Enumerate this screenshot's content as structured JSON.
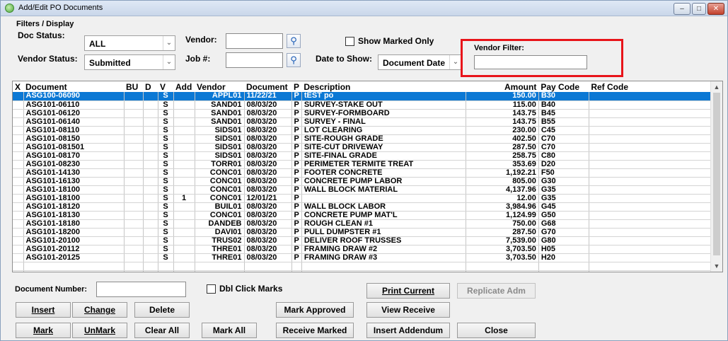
{
  "window": {
    "title": "Add/Edit PO Documents",
    "controls": {
      "minimize": "–",
      "maximize": "□",
      "close": "✕"
    }
  },
  "filters": {
    "section_title": "Filters / Display",
    "doc_status_label": "Doc Status:",
    "doc_status_value": "ALL",
    "vendor_status_label": "Vendor Status:",
    "vendor_status_value": "Submitted",
    "vendor_label": "Vendor:",
    "vendor_value": "",
    "job_label": "Job #:",
    "job_value": "",
    "show_marked_only_label": "Show Marked Only",
    "date_to_show_label": "Date to Show:",
    "date_to_show_value": "Document Date",
    "vendor_filter_label": "Vendor Filter:",
    "vendor_filter_value": ""
  },
  "grid": {
    "columns": [
      "X",
      "Document",
      "BU",
      "D",
      "V",
      "Add",
      "Vendor",
      "Document",
      "P",
      "Description",
      "Amount",
      "Pay Code",
      "Ref Code"
    ],
    "rows": [
      [
        "",
        "ASG100-06090",
        "",
        "",
        "S",
        "",
        "APPL01",
        "11/22/21",
        "P",
        "tEST po",
        "150.00",
        "B30",
        ""
      ],
      [
        "",
        "ASG101-06110",
        "",
        "",
        "S",
        "",
        "SAND01",
        "08/03/20",
        "P",
        "SURVEY-STAKE OUT",
        "115.00",
        "B40",
        ""
      ],
      [
        "",
        "ASG101-06120",
        "",
        "",
        "S",
        "",
        "SAND01",
        "08/03/20",
        "P",
        "SURVEY-FORMBOARD",
        "143.75",
        "B45",
        ""
      ],
      [
        "",
        "ASG101-06140",
        "",
        "",
        "S",
        "",
        "SAND01",
        "08/03/20",
        "P",
        "SURVEY - FINAL",
        "143.75",
        "B55",
        ""
      ],
      [
        "",
        "ASG101-08110",
        "",
        "",
        "S",
        "",
        "SIDS01",
        "08/03/20",
        "P",
        "LOT CLEARING",
        "230.00",
        "C45",
        ""
      ],
      [
        "",
        "ASG101-08150",
        "",
        "",
        "S",
        "",
        "SIDS01",
        "08/03/20",
        "P",
        "SITE-ROUGH GRADE",
        "402.50",
        "C70",
        ""
      ],
      [
        "",
        "ASG101-081501",
        "",
        "",
        "S",
        "",
        "SIDS01",
        "08/03/20",
        "P",
        "SITE-CUT DRIVEWAY",
        "287.50",
        "C70",
        ""
      ],
      [
        "",
        "ASG101-08170",
        "",
        "",
        "S",
        "",
        "SIDS01",
        "08/03/20",
        "P",
        "SITE-FINAL GRADE",
        "258.75",
        "C80",
        ""
      ],
      [
        "",
        "ASG101-08230",
        "",
        "",
        "S",
        "",
        "TORR01",
        "08/03/20",
        "P",
        "PERIMETER TERMITE TREAT",
        "353.69",
        "D20",
        ""
      ],
      [
        "",
        "ASG101-14130",
        "",
        "",
        "S",
        "",
        "CONC01",
        "08/03/20",
        "P",
        "FOOTER CONCRETE",
        "1,192.21",
        "F50",
        ""
      ],
      [
        "",
        "ASG101-16130",
        "",
        "",
        "S",
        "",
        "CONC01",
        "08/03/20",
        "P",
        "CONCRETE PUMP LABOR",
        "805.00",
        "G30",
        ""
      ],
      [
        "",
        "ASG101-18100",
        "",
        "",
        "S",
        "",
        "CONC01",
        "08/03/20",
        "P",
        "WALL BLOCK MATERIAL",
        "4,137.96",
        "G35",
        ""
      ],
      [
        "",
        "ASG101-18100",
        "",
        "",
        "S",
        "1",
        "CONC01",
        "12/01/21",
        "P",
        "",
        "12.00",
        "G35",
        ""
      ],
      [
        "",
        "ASG101-18120",
        "",
        "",
        "S",
        "",
        "BUIL01",
        "08/03/20",
        "P",
        "WALL BLOCK LABOR",
        "3,984.96",
        "G45",
        ""
      ],
      [
        "",
        "ASG101-18130",
        "",
        "",
        "S",
        "",
        "CONC01",
        "08/03/20",
        "P",
        "CONCRETE PUMP MAT'L",
        "1,124.99",
        "G50",
        ""
      ],
      [
        "",
        "ASG101-18180",
        "",
        "",
        "S",
        "",
        "DANDEB",
        "08/03/20",
        "P",
        "ROUGH CLEAN #1",
        "750.00",
        "G68",
        ""
      ],
      [
        "",
        "ASG101-18200",
        "",
        "",
        "S",
        "",
        "DAVI01",
        "08/03/20",
        "P",
        "PULL DUMPSTER #1",
        "287.50",
        "G70",
        ""
      ],
      [
        "",
        "ASG101-20100",
        "",
        "",
        "S",
        "",
        "TRUS02",
        "08/03/20",
        "P",
        "DELIVER ROOF TRUSSES",
        "7,539.00",
        "G80",
        ""
      ],
      [
        "",
        "ASG101-20112",
        "",
        "",
        "S",
        "",
        "THRE01",
        "08/03/20",
        "P",
        "FRAMING DRAW #2",
        "3,703.50",
        "H05",
        ""
      ],
      [
        "",
        "ASG101-20125",
        "",
        "",
        "S",
        "",
        "THRE01",
        "08/03/20",
        "P",
        "FRAMING DRAW #3",
        "3,703.50",
        "H20",
        ""
      ]
    ],
    "selected_row": 0
  },
  "bottom": {
    "document_number_label": "Document Number:",
    "document_number_value": "",
    "dbl_click_marks_label": "Dbl Click Marks",
    "print_current": "Print Current",
    "replicate_adm": "Replicate Adm",
    "insert": "Insert",
    "change": "Change",
    "delete": "Delete",
    "mark_approved": "Mark Approved",
    "view_receive": "View Receive",
    "mark": "Mark",
    "unmark": "UnMark",
    "clear_all": "Clear All",
    "mark_all": "Mark All",
    "receive_marked": "Receive Marked",
    "insert_addendum": "Insert Addendum",
    "close": "Close"
  },
  "icons": {
    "search": "⚲",
    "dropdown": "⌄",
    "scroll_up": "▲",
    "scroll_down": "▼"
  },
  "colors": {
    "selection": "#0b78d4",
    "highlight_border": "#e8141a"
  }
}
